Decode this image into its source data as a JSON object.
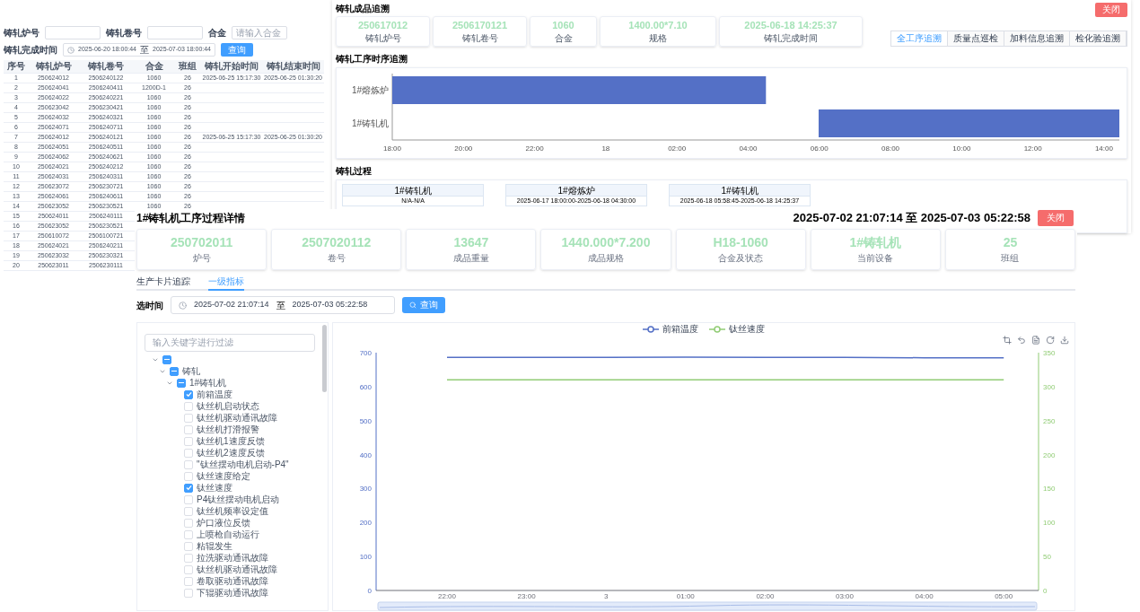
{
  "table_window": {
    "filters": [
      {
        "label": "铸轧炉号"
      },
      {
        "label": "铸轧卷号"
      },
      {
        "label": "合金",
        "placeholder": "请输入合金"
      }
    ],
    "date_filter": {
      "label": "铸轧完成时间",
      "start": "2025-06-20 18:00:44",
      "separator": "至",
      "end": "2025-07-03 18:00:44",
      "button": "查询"
    },
    "columns": [
      "序号",
      "铸轧炉号",
      "铸轧卷号",
      "合金",
      "班组",
      "铸轧开始时间",
      "铸轧结束时间"
    ],
    "rows": [
      {
        "no": "1",
        "furnace": "250624012",
        "coil": "2506240122",
        "alloy": "1060",
        "shift": "26",
        "start": "2025-06-25 15:17:30",
        "end": "2025-06-25 01:30:20"
      },
      {
        "no": "2",
        "furnace": "250624041",
        "coil": "2506240411",
        "alloy": "1200D-1",
        "shift": "26"
      },
      {
        "no": "3",
        "furnace": "250624022",
        "coil": "2506240221",
        "alloy": "1060",
        "shift": "26"
      },
      {
        "no": "4",
        "furnace": "250623042",
        "coil": "2506230421",
        "alloy": "1060",
        "shift": "26"
      },
      {
        "no": "5",
        "furnace": "250624032",
        "coil": "2506240321",
        "alloy": "1060",
        "shift": "26"
      },
      {
        "no": "6",
        "furnace": "250624071",
        "coil": "2506240711",
        "alloy": "1060",
        "shift": "26"
      },
      {
        "no": "7",
        "furnace": "250624012",
        "coil": "2506240121",
        "alloy": "1060",
        "shift": "26",
        "start": "2025-06-25 15:17:30",
        "end": "2025-06-25 01:30:20"
      },
      {
        "no": "8",
        "furnace": "250624051",
        "coil": "2506240511",
        "alloy": "1060",
        "shift": "26"
      },
      {
        "no": "9",
        "furnace": "250624062",
        "coil": "2506240621",
        "alloy": "1060",
        "shift": "26"
      },
      {
        "no": "10",
        "furnace": "250624021",
        "coil": "2506240212",
        "alloy": "1060",
        "shift": "26"
      },
      {
        "no": "11",
        "furnace": "250624031",
        "coil": "2506240311",
        "alloy": "1060",
        "shift": "26"
      },
      {
        "no": "12",
        "furnace": "250623072",
        "coil": "2506230721",
        "alloy": "1060",
        "shift": "26"
      },
      {
        "no": "13",
        "furnace": "250624061",
        "coil": "2506240611",
        "alloy": "1060",
        "shift": "26"
      },
      {
        "no": "14",
        "furnace": "250623052",
        "coil": "2506230521",
        "alloy": "1060",
        "shift": "26"
      },
      {
        "no": "15",
        "furnace": "250624011",
        "coil": "2506240111"
      },
      {
        "no": "16",
        "furnace": "250623052",
        "coil": "2506230521"
      },
      {
        "no": "17",
        "furnace": "250610072",
        "coil": "2506100721"
      },
      {
        "no": "18",
        "furnace": "250624021",
        "coil": "2506240211"
      },
      {
        "no": "19",
        "furnace": "250623032",
        "coil": "2506230321"
      },
      {
        "no": "20",
        "furnace": "250623011",
        "coil": "2506230111"
      }
    ]
  },
  "trace_window": {
    "title": "铸轧成品追溯",
    "close": "关闭",
    "stats": [
      {
        "value": "250617012",
        "label": "铸轧炉号"
      },
      {
        "value": "2506170121",
        "label": "铸轧卷号"
      },
      {
        "value": "1060",
        "label": "合金"
      },
      {
        "value": "1400.00*7.10",
        "label": "规格"
      },
      {
        "value": "2025-06-18 14:25:37",
        "label": "铸轧完成时间"
      }
    ],
    "tabs": [
      {
        "label": "全工序追溯",
        "selected": true
      },
      {
        "label": "质量点巡检",
        "selected": false
      },
      {
        "label": "加料信息追溯",
        "selected": false
      },
      {
        "label": "检化验追溯",
        "selected": false
      }
    ],
    "timeline": {
      "title": "铸轧工序时序追溯",
      "rows": [
        "1#熔炼炉",
        "1#铸轧机"
      ],
      "ticks": [
        "18:00",
        "20:00",
        "22:00",
        "18",
        "02:00",
        "04:00",
        "06:00",
        "08:00",
        "10:00",
        "12:00",
        "14:00"
      ]
    },
    "process": {
      "title": "铸轧过程",
      "steps": [
        {
          "equipment": "1#铸轧机",
          "period": "N/A-N/A"
        },
        {
          "equipment": "1#熔炼炉",
          "period": "2025-06-17 18:00:00-2025-06-18 04:30:00"
        },
        {
          "equipment": "1#铸轧机",
          "period": "2025-06-18 05:58:45-2025-06-18 14:25:37"
        }
      ]
    }
  },
  "detail_dialog": {
    "title": "1#铸轧机工序过程详情",
    "range": "2025-07-02 21:07:14 至 2025-07-03 05:22:58",
    "close": "关闭",
    "stats": [
      {
        "value": "250702011",
        "label": "炉号"
      },
      {
        "value": "2507020112",
        "label": "卷号"
      },
      {
        "value": "13647",
        "label": "成品重量"
      },
      {
        "value": "1440.000*7.200",
        "label": "成品规格"
      },
      {
        "value": "H18-1060",
        "label": "合金及状态"
      },
      {
        "value": "1#铸轧机",
        "label": "当前设备"
      },
      {
        "value": "25",
        "label": "班组"
      }
    ],
    "tabs": [
      {
        "label": "生产卡片追踪",
        "selected": false
      },
      {
        "label": "一级指标",
        "selected": true
      }
    ],
    "time_filter": {
      "label": "选时间",
      "start": "2025-07-02 21:07:14",
      "separator": "至",
      "end": "2025-07-03 05:22:58",
      "button": "查询"
    },
    "tree": {
      "placeholder": "输入关键字进行过滤",
      "nodes": [
        {
          "indeterminate": true,
          "expanded": true,
          "children": [
            {
              "label": "铸轧",
              "indeterminate": true,
              "expanded": true,
              "children": [
                {
                  "label": "1#铸轧机",
                  "indeterminate": true,
                  "expanded": true,
                  "children": [
                    {
                      "label": "前箱温度",
                      "checked": true
                    },
                    {
                      "label": "钛丝机启动状态",
                      "checked": false
                    },
                    {
                      "label": "钛丝机驱动通讯故障",
                      "checked": false
                    },
                    {
                      "label": "钛丝机打滑报警",
                      "checked": false
                    },
                    {
                      "label": "钛丝机1速度反馈",
                      "checked": false
                    },
                    {
                      "label": "钛丝机2速度反馈",
                      "checked": false
                    },
                    {
                      "label": "\"钛丝摆动电机启动-P4\"",
                      "checked": false
                    },
                    {
                      "label": "钛丝速度给定",
                      "checked": false
                    },
                    {
                      "label": "钛丝速度",
                      "checked": true
                    },
                    {
                      "label": "P4钛丝摆动电机启动",
                      "checked": false
                    },
                    {
                      "label": "钛丝机频率设定值",
                      "checked": false
                    },
                    {
                      "label": "炉口液位反馈",
                      "checked": false
                    },
                    {
                      "label": "上喷枪自动运行",
                      "checked": false
                    },
                    {
                      "label": "粘辊发生",
                      "checked": false
                    },
                    {
                      "label": "拉洗驱动通讯故障",
                      "checked": false
                    },
                    {
                      "label": "钛丝机驱动通讯故障",
                      "checked": false
                    },
                    {
                      "label": "卷取驱动通讯故障",
                      "checked": false
                    },
                    {
                      "label": "下辊驱动通讯故障",
                      "checked": false
                    }
                  ]
                }
              ]
            }
          ]
        }
      ]
    },
    "chart_data": {
      "type": "line",
      "categories": [
        "22:00",
        "23:00",
        "3",
        "01:00",
        "02:00",
        "03:00",
        "04:00",
        "05:00"
      ],
      "series": [
        {
          "name": "前箱温度",
          "color": "#5470c6",
          "values": [
            686,
            686,
            686,
            687,
            686,
            686,
            685,
            685
          ]
        },
        {
          "name": "钛丝速度",
          "color": "#91cc75",
          "axis": "y2",
          "values": [
            310,
            310,
            310,
            310,
            310,
            310,
            310,
            310
          ]
        }
      ],
      "ylim": [
        0,
        700
      ],
      "yticks": [
        0,
        100,
        200,
        300,
        400,
        500,
        600,
        700
      ],
      "legend": "top",
      "y2lim": [
        0,
        350
      ],
      "y2ticks": [
        0,
        50,
        100,
        150,
        200,
        250,
        300,
        350
      ]
    }
  }
}
